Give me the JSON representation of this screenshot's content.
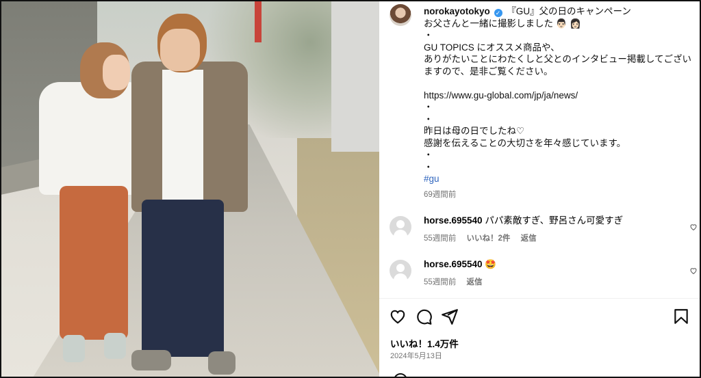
{
  "post": {
    "username": "norokayotokyo",
    "caption_lines": [
      "『GU』父の日のキャンペーン",
      "お父さんと一緒に撮影しました 👨🏻 👩🏻",
      "・",
      "GU TOPICS にオススメ商品や、",
      "ありがたいことにわたくしと父とのインタビュー掲載してござい",
      "ますので、是非ご覧ください。",
      "",
      "https://www.gu-global.com/jp/ja/news/",
      "・",
      "・",
      "昨日は母の日でしたね♡",
      "感謝を伝えることの大切さを年々感じています。",
      "・",
      "・"
    ],
    "hashtag": "#gu",
    "age": "69週間前"
  },
  "comments": [
    {
      "username": "horse.695540",
      "text": "パパ素敵すぎ、野呂さん可愛すぎ",
      "age": "55週間前",
      "likes": "いいね！2件",
      "reply": "返信"
    },
    {
      "username": "horse.695540",
      "text": "🤩",
      "age": "55週間前",
      "likes": "",
      "reply": "返信"
    }
  ],
  "footer": {
    "likes": "いいね！1.4万件",
    "date": "2024年5月13日"
  },
  "icons": {
    "verified": "verified-badge-icon",
    "like": "heart-icon",
    "comment": "comment-bubble-icon",
    "share": "paper-plane-icon",
    "save": "bookmark-icon"
  },
  "colors": {
    "verified": "#3797f0",
    "hashtag": "#3066be",
    "meta": "#737373"
  }
}
